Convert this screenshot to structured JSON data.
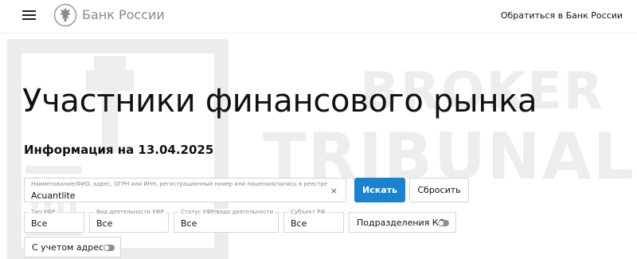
{
  "header": {
    "logo_text": "Банк России",
    "contact_link": "Обратиться в Банк России"
  },
  "watermark": {
    "line1": "BROKER",
    "line2": "TRIBUNAL"
  },
  "page": {
    "title": "Участники финансового рынка",
    "info_date": "Информация на 13.04.2025"
  },
  "search": {
    "label": "Наименование/ФИО, адрес, ОГРН или ИНН, регистрационный номер или лицензия/запись в реестре",
    "value": "Acuantlite",
    "clear_symbol": "×",
    "search_button": "Искать",
    "reset_button": "Сбросить"
  },
  "filters": {
    "type": {
      "label": "Тип УФР",
      "value": "Все"
    },
    "activity": {
      "label": "Вид деятельности УФР",
      "value": "Все"
    },
    "status": {
      "label": "Статус УФР/вида деятельности",
      "value": "Все"
    },
    "subject": {
      "label": "Субъект РФ",
      "value": "Все"
    },
    "branches_toggle": "Подразделения КО",
    "address_toggle": "С учетом адреса"
  },
  "colors": {
    "accent": "#1a83d1",
    "watermark": "#ededed"
  },
  "icons": [
    "menu-icon",
    "bank-emblem-icon",
    "clear-icon"
  ]
}
